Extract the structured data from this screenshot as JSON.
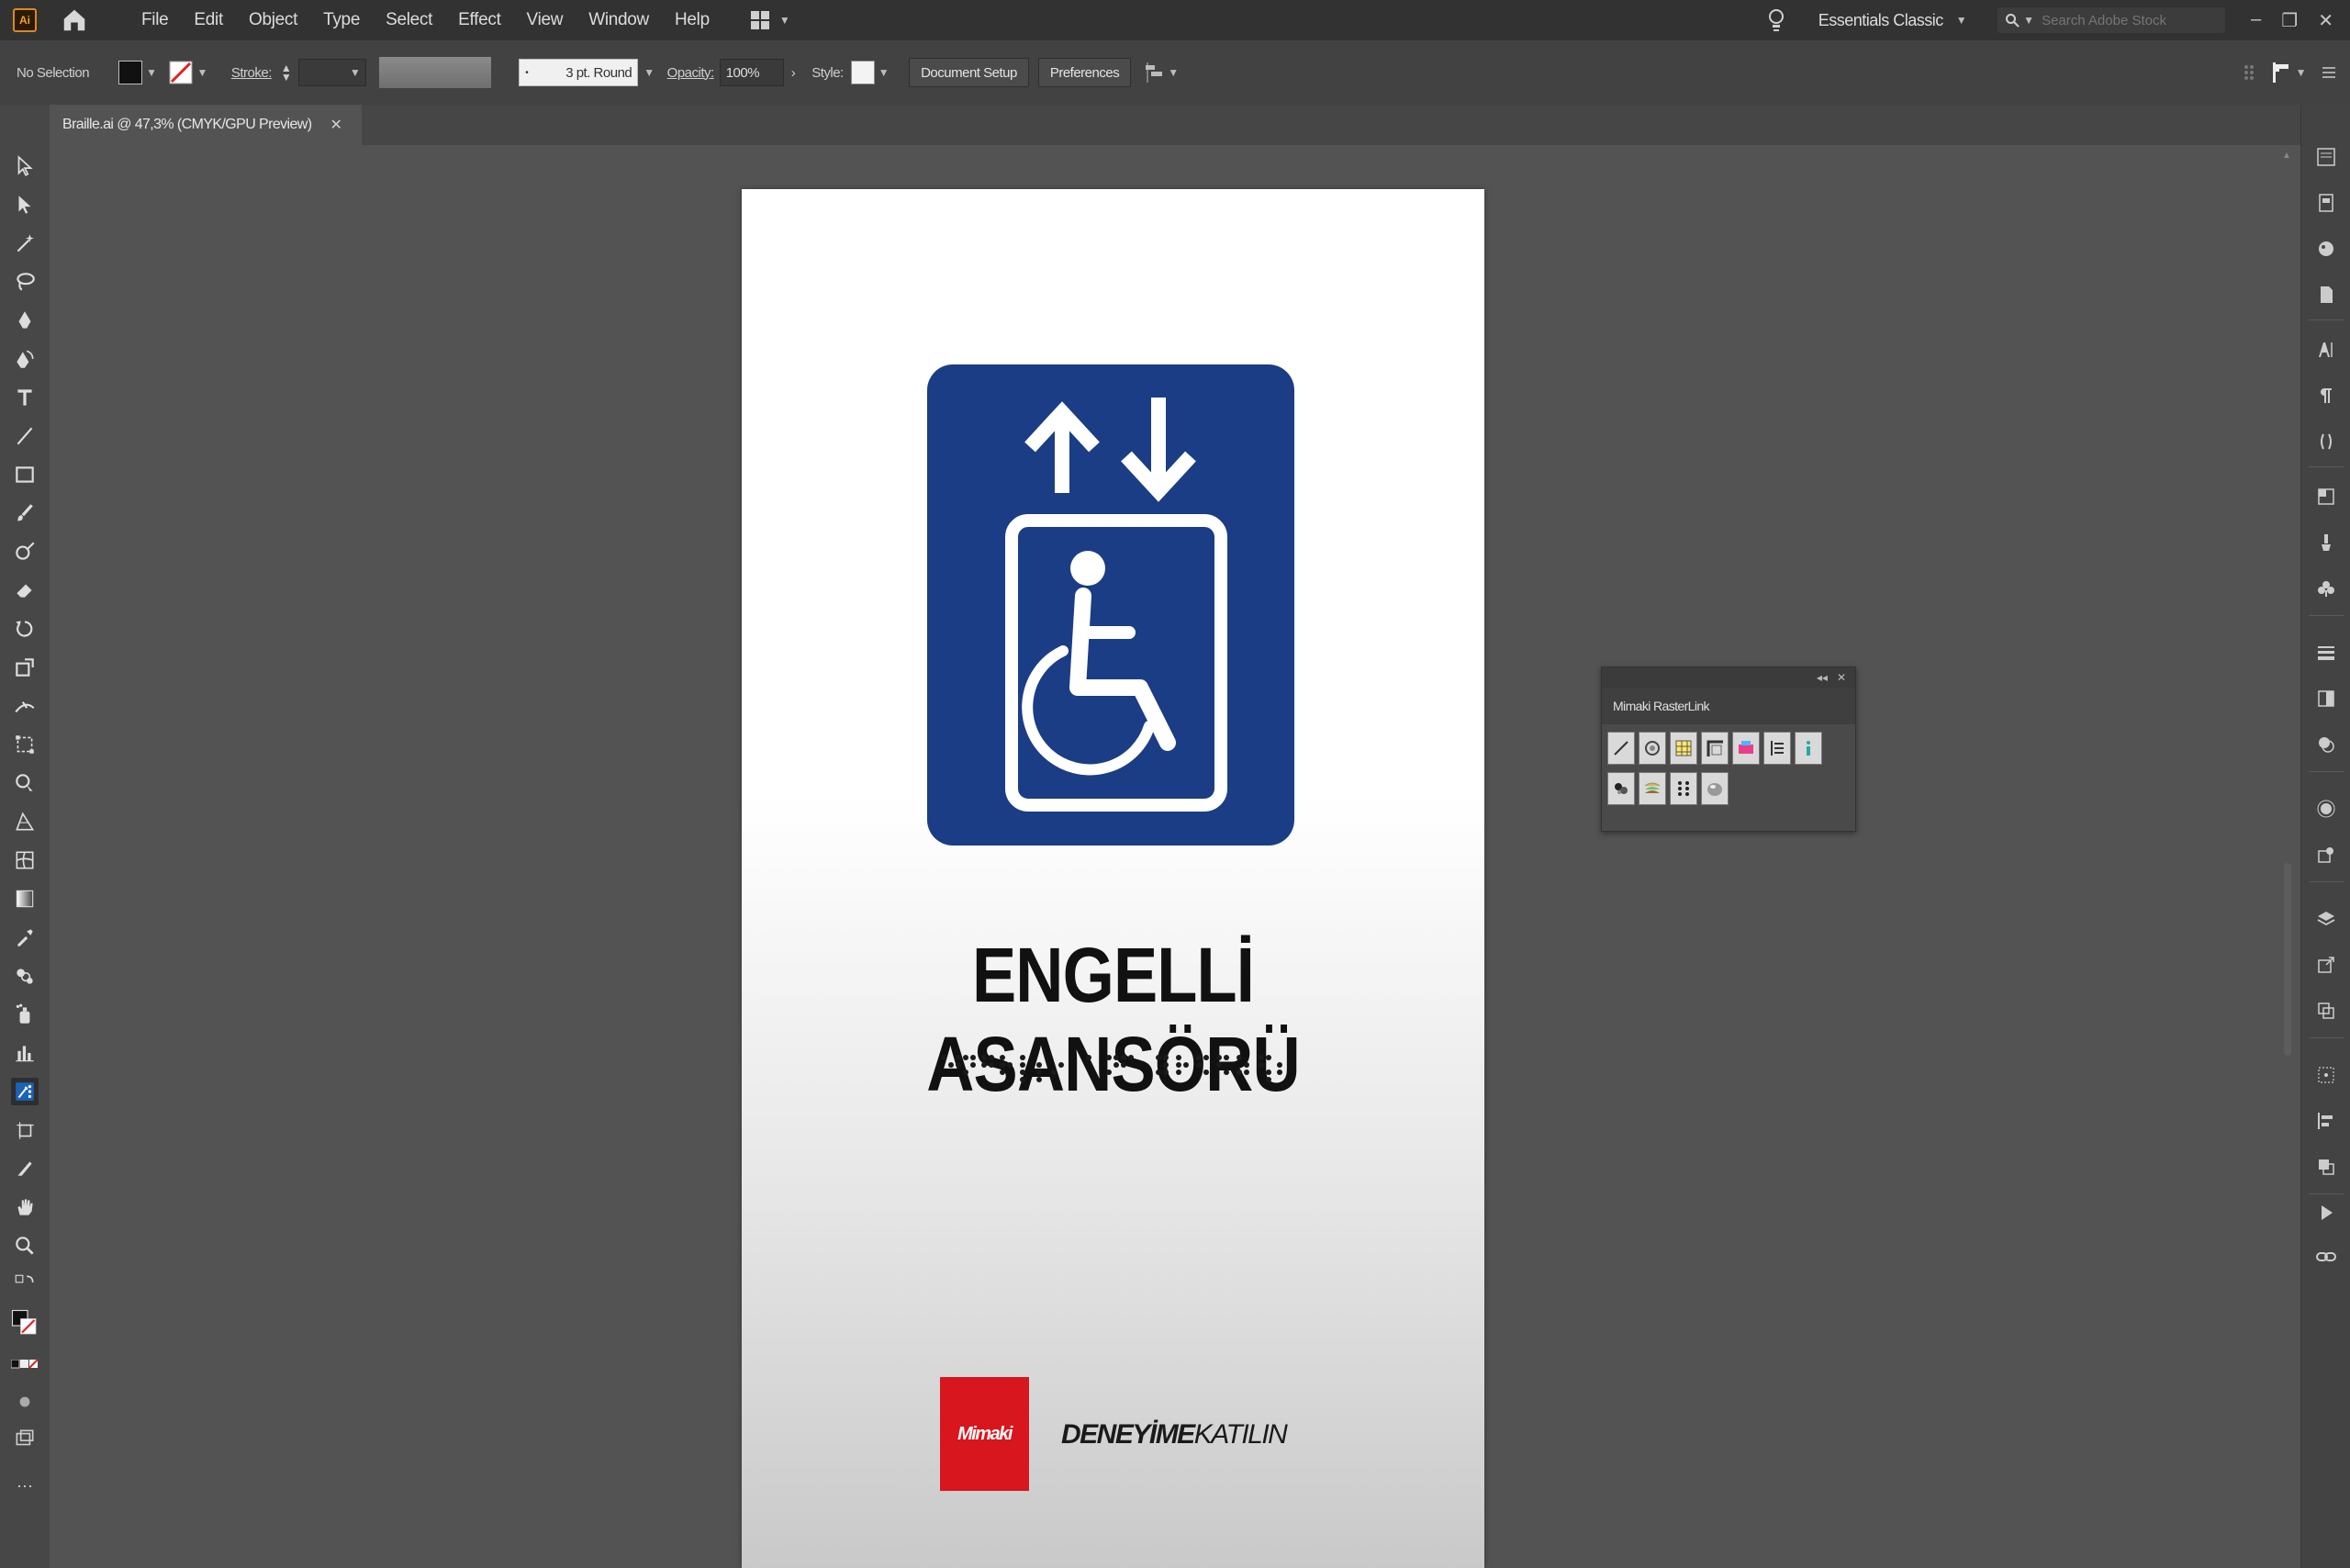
{
  "app": {
    "logo": "Ai"
  },
  "menu": {
    "items": [
      "File",
      "Edit",
      "Object",
      "Type",
      "Select",
      "Effect",
      "View",
      "Window",
      "Help"
    ]
  },
  "workspace": {
    "label": "Essentials Classic"
  },
  "stock_search": {
    "placeholder": "Search Adobe Stock"
  },
  "controlbar": {
    "selection": "No Selection",
    "stroke_label": "Stroke:",
    "brush": "3 pt. Round",
    "opacity_label": "Opacity:",
    "opacity_value": "100%",
    "style_label": "Style:",
    "document_setup": "Document Setup",
    "preferences": "Preferences"
  },
  "document": {
    "tab_title": "Braille.ai @ 47,3% (CMYK/GPU Preview)"
  },
  "artboard": {
    "title": "ENGELLİ ASANSÖRÜ",
    "logo_text": "Mimaki",
    "tagline_bold": "DENEYİME",
    "tagline_regular": "KATILIN",
    "sign_color": "#1b3d85",
    "logo_color": "#d7161d"
  },
  "panel": {
    "title": "Mimaki RasterLink"
  }
}
